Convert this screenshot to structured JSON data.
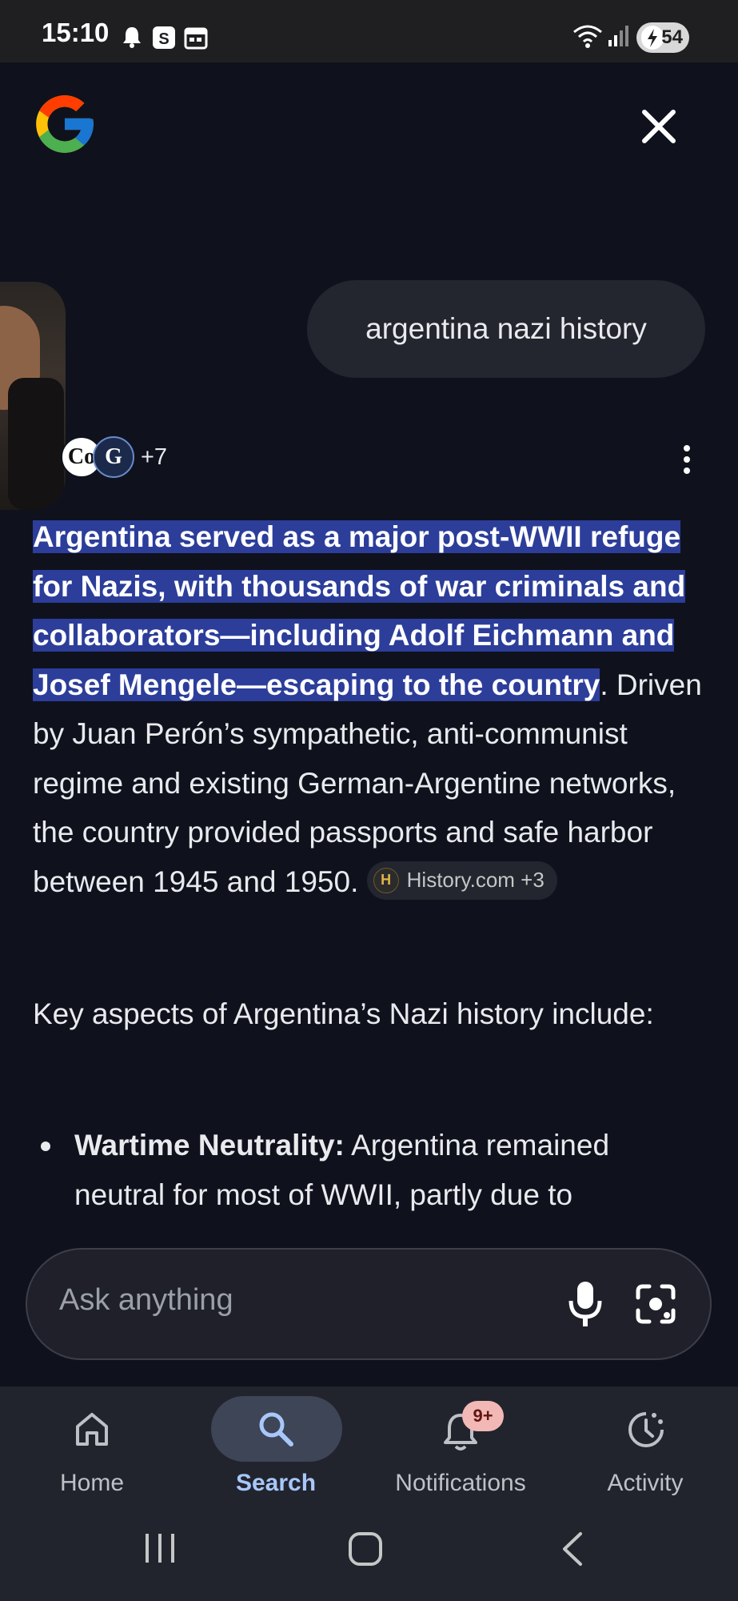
{
  "status_bar": {
    "time": "15:10",
    "battery": "54",
    "icons": [
      "bell-icon",
      "s-app-icon",
      "calendar-icon",
      "wifi-icon",
      "signal-icon",
      "battery-charging-icon"
    ]
  },
  "header": {
    "logo": "google-g-logo",
    "close_icon": "close-icon"
  },
  "query": {
    "text": "argentina nazi history"
  },
  "sources": {
    "icon1_letters": "Co",
    "icon2_letters": "G",
    "count": "+7"
  },
  "answer": {
    "highlighted": "Argentina served as a major post-WWII refuge for Nazis, with thousands of war criminals and collaborators—including Adolf Eichmann and Josef Mengele—escaping to the country",
    "rest": ". Driven by Juan Perón’s sympathetic, anti-communist regime and existing German-Argentine networks, the country provided passports and safe harbor between 1945 and 1950.",
    "citation_chip": "History.com +3",
    "citation_icon_letter": "H"
  },
  "intro": "Key aspects of Argentina’s Nazi history include:",
  "bullets": [
    {
      "title": "Wartime Neutrality:",
      "text": " Argentina remained neutral for most of WWII, partly due to"
    }
  ],
  "ask": {
    "placeholder": "Ask anything"
  },
  "bottom_nav": {
    "items": [
      {
        "label": "Home",
        "icon": "home-icon"
      },
      {
        "label": "Search",
        "icon": "search-icon",
        "active": true
      },
      {
        "label": "Notifications",
        "icon": "bell-icon",
        "badge": "9+"
      },
      {
        "label": "Activity",
        "icon": "activity-icon"
      }
    ]
  },
  "colors": {
    "background": "#0f121d",
    "highlight": "#2c3e9a",
    "active_nav": "#a8c7fa",
    "badge": "#f2b8b5"
  }
}
